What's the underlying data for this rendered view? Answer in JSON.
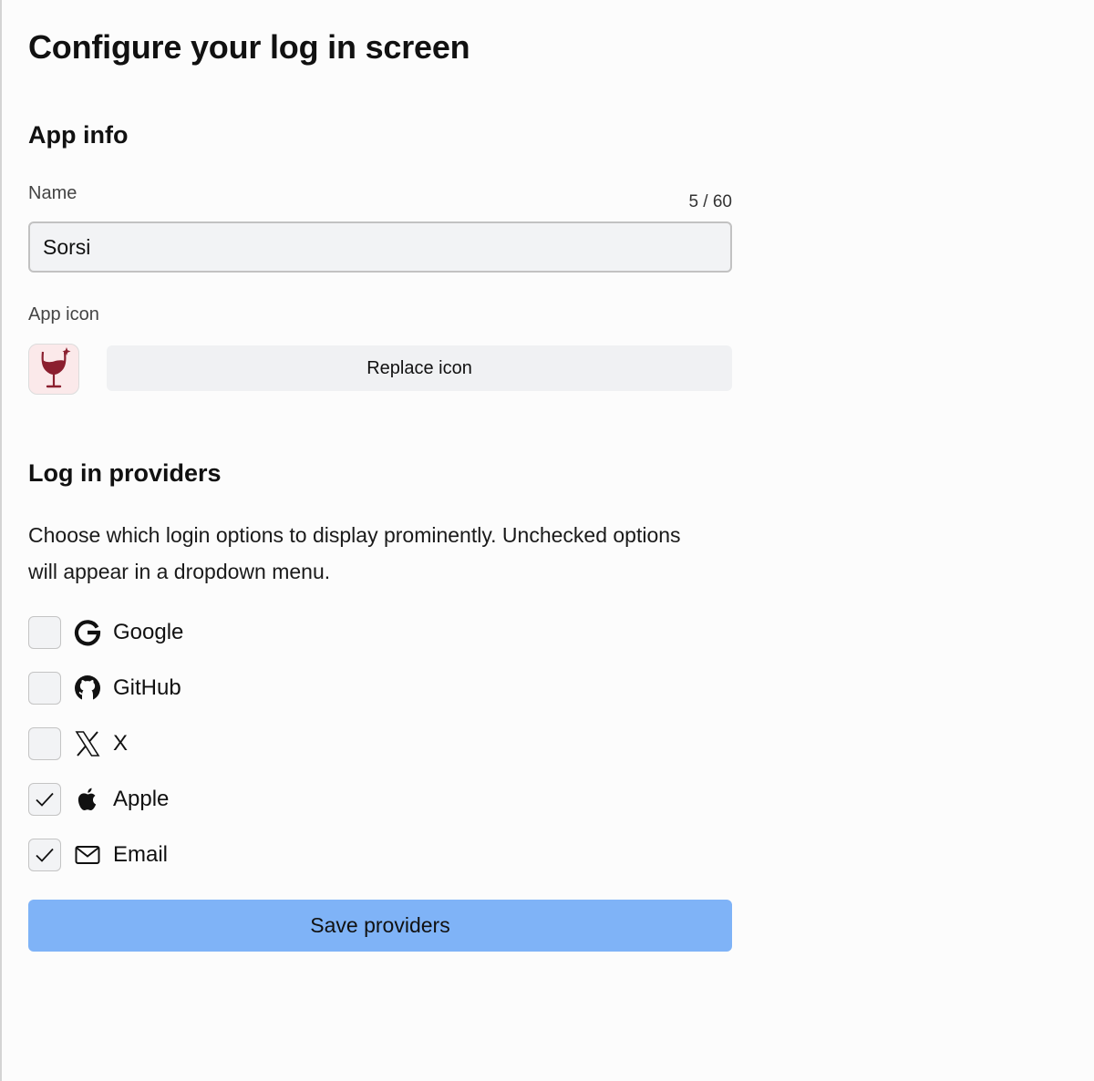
{
  "page": {
    "title": "Configure your log in screen"
  },
  "app_info": {
    "heading": "App info",
    "name_label": "Name",
    "name_value": "Sorsi",
    "char_count": "5 / 60",
    "icon_label": "App icon",
    "icon_name": "wine-glass-icon",
    "replace_icon_label": "Replace icon"
  },
  "providers": {
    "heading": "Log in providers",
    "description": "Choose which login options to display prominently. Unchecked options will appear in a dropdown menu.",
    "items": [
      {
        "label": "Google",
        "icon": "google-icon",
        "checked": false
      },
      {
        "label": "GitHub",
        "icon": "github-icon",
        "checked": false
      },
      {
        "label": "X",
        "icon": "x-icon",
        "checked": false
      },
      {
        "label": "Apple",
        "icon": "apple-icon",
        "checked": true
      },
      {
        "label": "Email",
        "icon": "envelope-icon",
        "checked": true
      }
    ],
    "save_label": "Save providers"
  },
  "colors": {
    "background": "#fcfcfc",
    "primary_button": "#7fb3f7",
    "input_background": "#f2f3f5",
    "app_icon_background": "#fbe9ea",
    "wine": "#8b1f2f"
  }
}
